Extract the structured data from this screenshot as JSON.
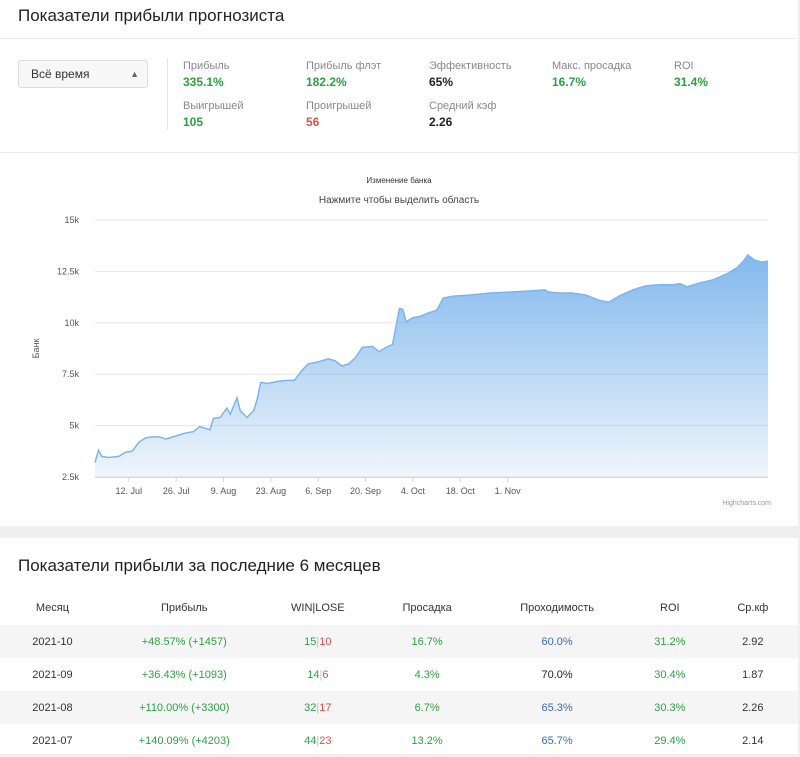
{
  "section1": {
    "title": "Показатели прибыли прогнозиста"
  },
  "filter": {
    "value": "Всё время"
  },
  "stats": [
    {
      "label": "Прибыль",
      "value": "335.1%",
      "color": "green"
    },
    {
      "label": "Прибыль флэт",
      "value": "182.2%",
      "color": "green"
    },
    {
      "label": "Эффективность",
      "value": "65%",
      "color": "dark"
    },
    {
      "label": "Макс. просадка",
      "value": "16.7%",
      "color": "green"
    },
    {
      "label": "ROI",
      "value": "31.4%",
      "color": "green"
    },
    {
      "label": "Выигрышей",
      "value": "105",
      "color": "green"
    },
    {
      "label": "Проигрышей",
      "value": "56",
      "color": "red"
    },
    {
      "label": "Средний кэф",
      "value": "2.26",
      "color": "dark"
    }
  ],
  "chart_data": {
    "type": "area",
    "title": "Изменение банка",
    "subtitle": "Нажмите чтобы выделить область",
    "ylabel": "Банк",
    "credit": "Highcharts.com",
    "ylim": [
      2500,
      15000
    ],
    "yticks": [
      2500,
      5000,
      7500,
      10000,
      12500,
      15000
    ],
    "ytick_labels": [
      "2.5k",
      "5k",
      "7.5k",
      "10k",
      "12.5k",
      "15k"
    ],
    "xtick_labels": [
      "12. Jul",
      "26. Jul",
      "9. Aug",
      "23. Aug",
      "6. Sep",
      "20. Sep",
      "4. Oct",
      "18. Oct",
      "1. Nov"
    ],
    "xtick_days": [
      11,
      25,
      39,
      53,
      67,
      81,
      95,
      109,
      123
    ],
    "xlim": [
      1,
      133
    ],
    "color": "#7cb5ec",
    "grid": true,
    "series": [
      {
        "values": [
          [
            1,
            3200
          ],
          [
            2,
            3800
          ],
          [
            3,
            3500
          ],
          [
            5,
            3450
          ],
          [
            8,
            3500
          ],
          [
            10,
            3700
          ],
          [
            12,
            3750
          ],
          [
            14,
            4200
          ],
          [
            16,
            4400
          ],
          [
            18,
            4450
          ],
          [
            20,
            4450
          ],
          [
            22,
            4350
          ],
          [
            24,
            4450
          ],
          [
            26,
            4550
          ],
          [
            28,
            4650
          ],
          [
            30,
            4700
          ],
          [
            32,
            4950
          ],
          [
            34,
            4850
          ],
          [
            35,
            4800
          ],
          [
            36,
            5350
          ],
          [
            38,
            5400
          ],
          [
            40,
            5850
          ],
          [
            41,
            5550
          ],
          [
            43,
            6350
          ],
          [
            44,
            5700
          ],
          [
            46,
            5400
          ],
          [
            48,
            5750
          ],
          [
            49,
            6300
          ],
          [
            50,
            7100
          ],
          [
            52,
            7050
          ],
          [
            55,
            7150
          ],
          [
            58,
            7200
          ],
          [
            60,
            7200
          ],
          [
            62,
            7650
          ],
          [
            64,
            8000
          ],
          [
            67,
            8100
          ],
          [
            70,
            8250
          ],
          [
            72,
            8150
          ],
          [
            74,
            7900
          ],
          [
            76,
            8000
          ],
          [
            78,
            8300
          ],
          [
            80,
            8800
          ],
          [
            83,
            8850
          ],
          [
            85,
            8600
          ],
          [
            87,
            8800
          ],
          [
            89,
            8950
          ],
          [
            91,
            10700
          ],
          [
            92,
            10650
          ],
          [
            93,
            10050
          ],
          [
            95,
            10250
          ],
          [
            97,
            10300
          ],
          [
            100,
            10500
          ],
          [
            102,
            10600
          ],
          [
            104,
            11200
          ],
          [
            107,
            11300
          ],
          [
            112,
            11350
          ],
          [
            118,
            11450
          ],
          [
            124,
            11500
          ],
          [
            130,
            11550
          ],
          [
            134,
            11600
          ],
          [
            135,
            11500
          ],
          [
            138,
            11450
          ],
          [
            142,
            11450
          ],
          [
            146,
            11350
          ],
          [
            150,
            11100
          ],
          [
            153,
            11000
          ],
          [
            156,
            11300
          ],
          [
            160,
            11600
          ],
          [
            164,
            11800
          ],
          [
            168,
            11850
          ],
          [
            172,
            11850
          ],
          [
            174,
            11900
          ],
          [
            176,
            11750
          ],
          [
            180,
            11950
          ],
          [
            184,
            12100
          ],
          [
            188,
            12400
          ],
          [
            191,
            12700
          ],
          [
            193,
            13050
          ],
          [
            194,
            13300
          ],
          [
            196,
            13050
          ],
          [
            198,
            12950
          ],
          [
            200,
            13000
          ]
        ]
      }
    ]
  },
  "section2": {
    "title": "Показатели прибыли за последние 6 месяцев"
  },
  "table": {
    "headers": [
      "Месяц",
      "Прибыль",
      "WIN|LOSE",
      "Просадка",
      "Проходимость",
      "ROI",
      "Ср.кф"
    ],
    "rows": [
      {
        "month": "2021-10",
        "profit": "+48.57% (+1457)",
        "win": "15",
        "lose": "10",
        "drawdown": "16.7%",
        "pass": "60.0%",
        "pass_color": "blue",
        "roi": "31.2%",
        "coef": "2.92"
      },
      {
        "month": "2021-09",
        "profit": "+36.43% (+1093)",
        "win": "14",
        "lose": "6",
        "drawdown": "4.3%",
        "pass": "70.0%",
        "pass_color": "dark",
        "roi": "30.4%",
        "coef": "1.87"
      },
      {
        "month": "2021-08",
        "profit": "+110.00% (+3300)",
        "win": "32",
        "lose": "17",
        "drawdown": "6.7%",
        "pass": "65.3%",
        "pass_color": "blue",
        "roi": "30.3%",
        "coef": "2.26"
      },
      {
        "month": "2021-07",
        "profit": "+140.09% (+4203)",
        "win": "44",
        "lose": "23",
        "drawdown": "13.2%",
        "pass": "65.7%",
        "pass_color": "blue",
        "roi": "29.4%",
        "coef": "2.14"
      }
    ]
  }
}
